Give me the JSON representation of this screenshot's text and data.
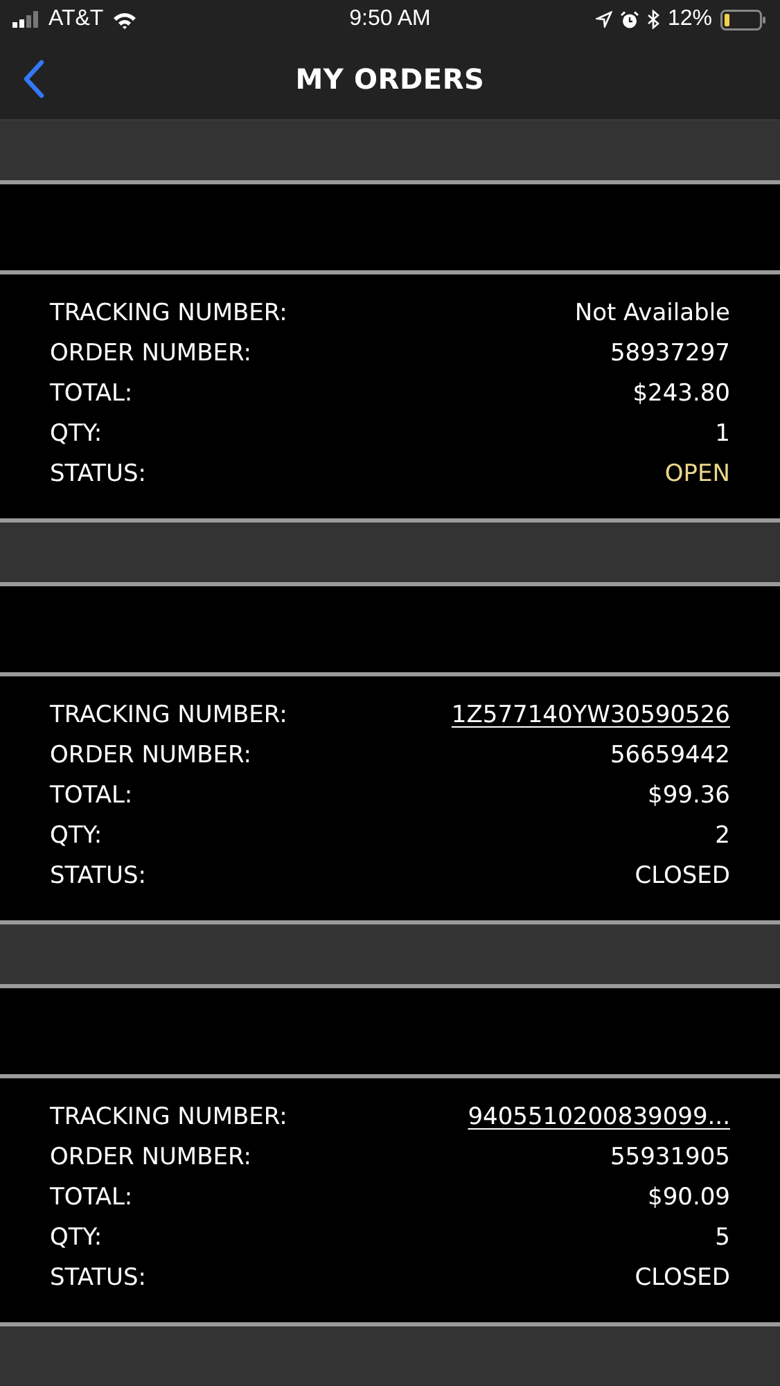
{
  "status_bar": {
    "carrier": "AT&T",
    "time": "9:50 AM",
    "battery": "12%"
  },
  "nav": {
    "title": "MY ORDERS"
  },
  "orders": [
    {
      "fields": [
        {
          "label": "TRACKING NUMBER:",
          "value": "Not Available",
          "kind": "text"
        },
        {
          "label": "ORDER NUMBER:",
          "value": "58937297",
          "kind": "text"
        },
        {
          "label": "TOTAL:",
          "value": "$243.80",
          "kind": "text"
        },
        {
          "label": "QTY:",
          "value": "1",
          "kind": "text"
        },
        {
          "label": "STATUS:",
          "value": "OPEN",
          "kind": "open"
        }
      ]
    },
    {
      "fields": [
        {
          "label": "TRACKING NUMBER:",
          "value": "1Z577140YW30590526",
          "kind": "link"
        },
        {
          "label": "ORDER NUMBER:",
          "value": "56659442",
          "kind": "text"
        },
        {
          "label": "TOTAL:",
          "value": "$99.36",
          "kind": "text"
        },
        {
          "label": "QTY:",
          "value": "2",
          "kind": "text"
        },
        {
          "label": "STATUS:",
          "value": "CLOSED",
          "kind": "text"
        }
      ]
    },
    {
      "fields": [
        {
          "label": "TRACKING NUMBER:",
          "value": "9405510200839099...",
          "kind": "link"
        },
        {
          "label": "ORDER NUMBER:",
          "value": "55931905",
          "kind": "text"
        },
        {
          "label": "TOTAL:",
          "value": "$90.09",
          "kind": "text"
        },
        {
          "label": "QTY:",
          "value": "5",
          "kind": "text"
        },
        {
          "label": "STATUS:",
          "value": "CLOSED",
          "kind": "text"
        }
      ]
    }
  ]
}
